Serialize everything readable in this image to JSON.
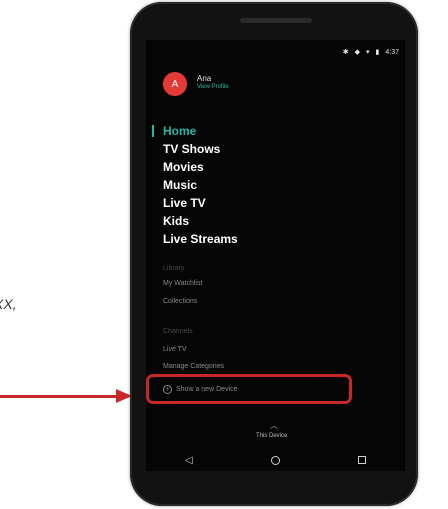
{
  "page": {
    "side_text": "XX,"
  },
  "status": {
    "bluetooth": "✱",
    "signal": "◆",
    "wifi": "▾",
    "battery": "▮",
    "time": "4:37"
  },
  "profile": {
    "initial": "A",
    "name": "Ana",
    "link": "View Profile"
  },
  "nav": [
    {
      "label": "Home",
      "active": true
    },
    {
      "label": "TV Shows"
    },
    {
      "label": "Movies"
    },
    {
      "label": "Music"
    },
    {
      "label": "Live TV"
    },
    {
      "label": "Kids"
    },
    {
      "label": "Live Streams"
    }
  ],
  "library": {
    "header": "Library",
    "items": [
      "My Watchlist",
      "Collections"
    ]
  },
  "channels": {
    "header": "Channels",
    "items": [
      "Live TV",
      "Manage Categories"
    ]
  },
  "device": {
    "show_new": "Show a new Device",
    "plus": "+",
    "caret": "︿",
    "current": "This Device"
  },
  "navbar": {
    "back": "◁"
  },
  "colors": {
    "accent": "#26b5a5",
    "avatar": "#e53935",
    "highlight": "#c62828"
  },
  "icons": [
    "bluetooth-icon",
    "signal-icon",
    "wifi-icon",
    "battery-icon",
    "plus-circle-icon",
    "chevron-up-icon",
    "back-icon",
    "home-icon",
    "recents-icon"
  ]
}
